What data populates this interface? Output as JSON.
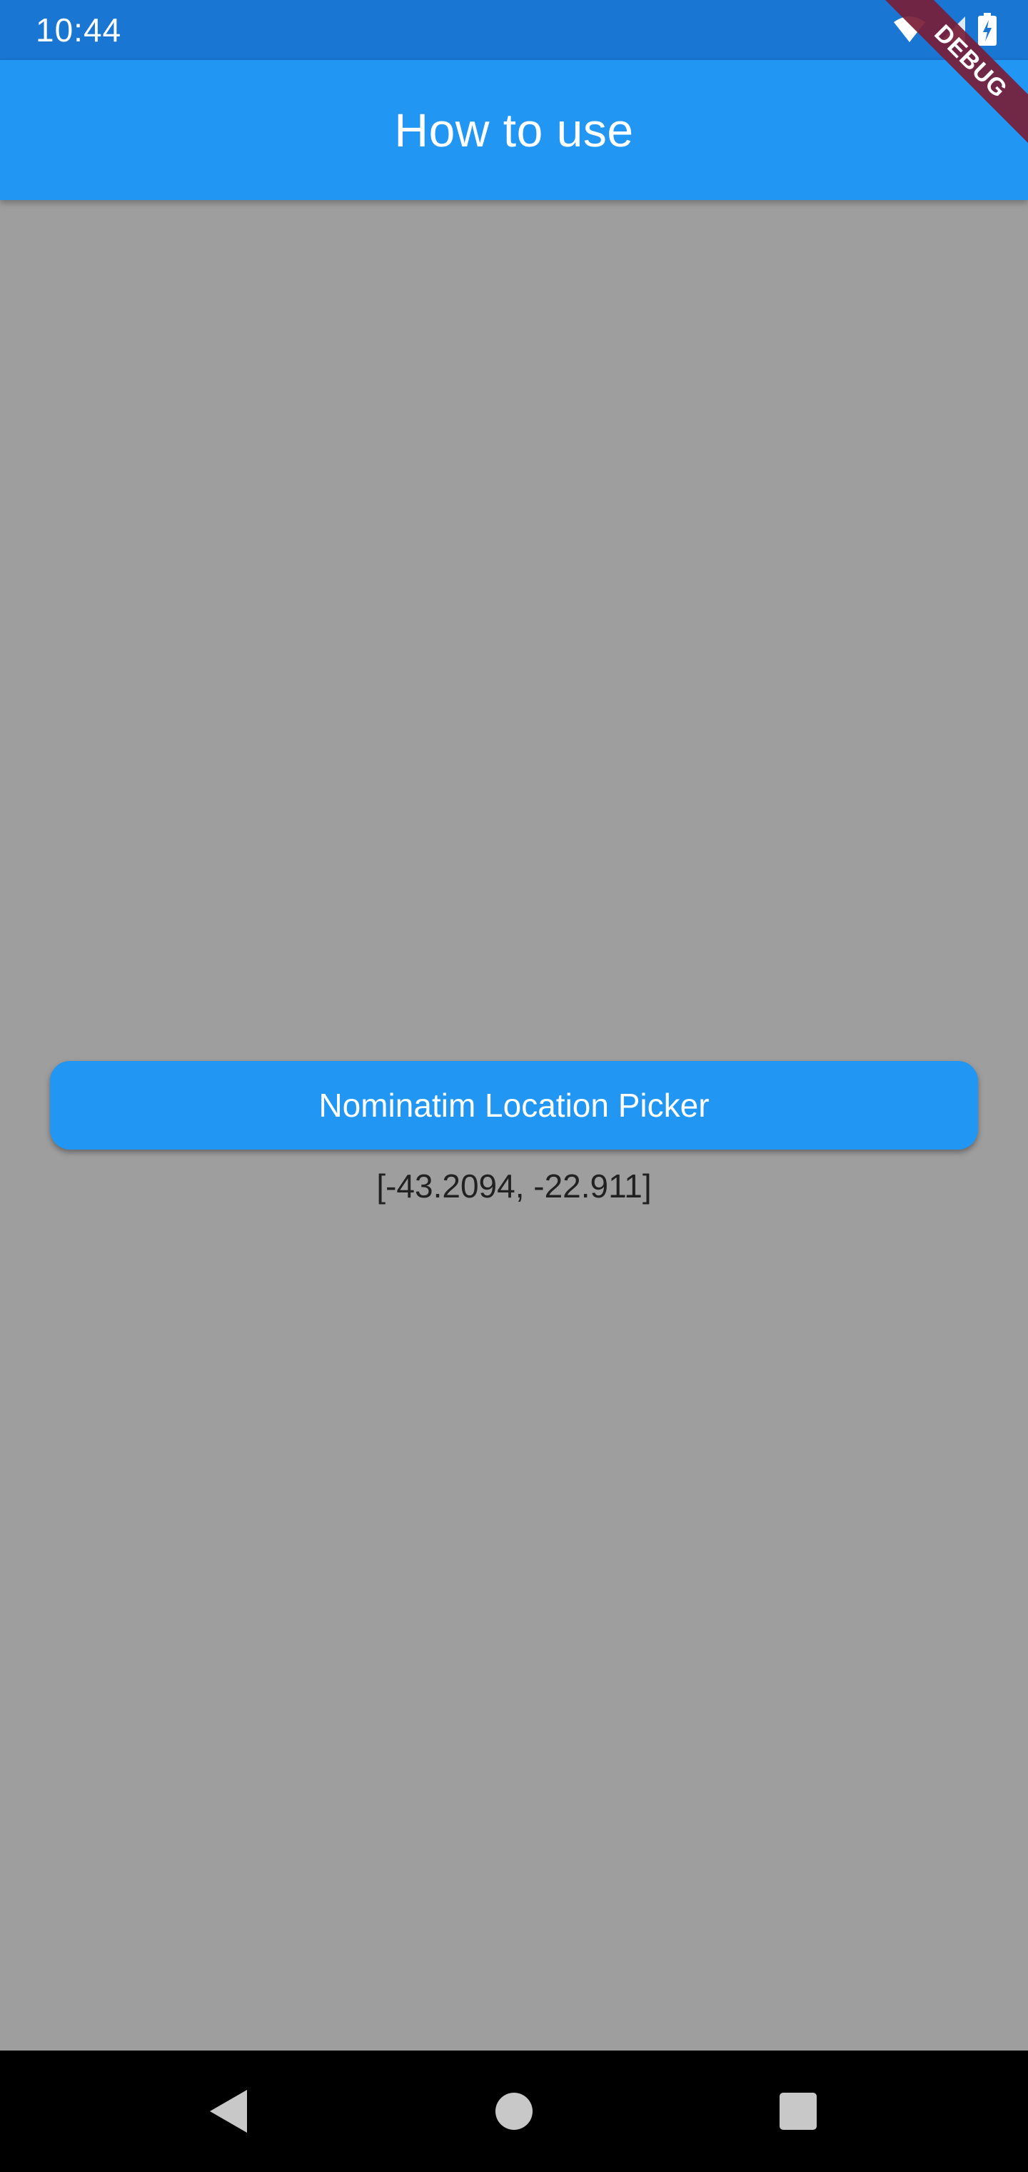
{
  "status_bar": {
    "time": "10:44",
    "icons": [
      "wifi-icon",
      "cell-signal-icon",
      "battery-charging-icon"
    ]
  },
  "app_bar": {
    "title": "How to use"
  },
  "debug_banner": {
    "label": "DEBUG"
  },
  "main": {
    "picker_button_label": "Nominatim Location Picker",
    "coordinates_text": "[-43.2094, -22.911]"
  },
  "nav_bar": {
    "buttons": [
      "back",
      "home",
      "recents"
    ]
  },
  "colors": {
    "status_bar": "#1976d2",
    "app_bar": "#2196f3",
    "background": "#9e9e9e",
    "button": "#2196f3",
    "debug_ribbon": "#781e37",
    "nav_bar": "#000000"
  }
}
